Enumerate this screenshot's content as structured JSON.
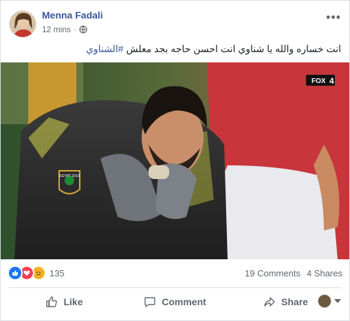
{
  "post": {
    "author": "Menna Fadali",
    "timestamp": "12 mins",
    "audience_icon": "globe-icon",
    "more_icon": "more-options-icon",
    "more_label": "•••",
    "caption_text": "انت خساره والله يا شناوي انت احسن حاجه بجد معلش ",
    "caption_hashtag": "#الشناوي",
    "photo_badge": "FOX",
    "photo_badge_number": "4",
    "jersey_text": "EGYPT 2019"
  },
  "reactions": {
    "icons": [
      "like-icon",
      "love-icon",
      "sad-icon"
    ],
    "count": "135",
    "comments": "19 Comments",
    "shares": "4 Shares"
  },
  "actions": {
    "like": "Like",
    "comment": "Comment",
    "share": "Share"
  },
  "colors": {
    "link_blue": "#385898",
    "like_blue": "#1877f2",
    "love_red": "#f33e58",
    "haha_yellow": "#f7b125",
    "muted": "#606770"
  }
}
